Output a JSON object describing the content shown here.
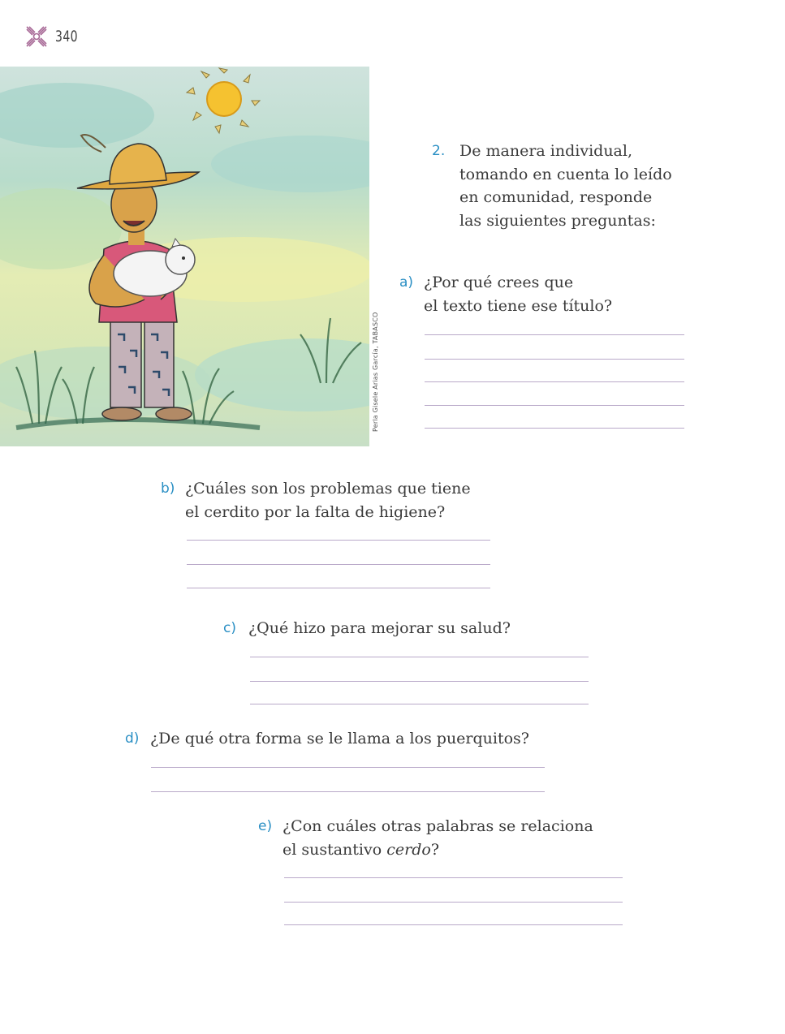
{
  "header": {
    "page_number": "340",
    "logo_icon": "decorative-cross-ornament-icon"
  },
  "illustration": {
    "description_icon": "farmer-holding-piglet-illustration",
    "credit": "Perla Gisele Arias García, TABASCO"
  },
  "activity": {
    "number": "2.",
    "instruction": [
      "De manera individual,",
      "tomando en cuenta lo leído",
      "en comunidad, responde",
      "las siguientes preguntas:"
    ]
  },
  "questions": {
    "a": {
      "label": "a)",
      "lines": [
        "¿Por qué crees que",
        "el texto tiene ese título?"
      ]
    },
    "b": {
      "label": "b)",
      "lines": [
        "¿Cuáles son los problemas que tiene",
        "el cerdito por la falta de higiene?"
      ]
    },
    "c": {
      "label": "c)",
      "lines": [
        "¿Qué hizo para mejorar su salud?"
      ]
    },
    "d": {
      "label": "d)",
      "lines": [
        "¿De qué otra forma se le llama a los puerquitos?"
      ]
    },
    "e": {
      "label": "e)",
      "line1": "¿Con cuáles otras palabras se relaciona",
      "line2_prefix": "el sustantivo ",
      "line2_em": "cerdo",
      "line2_suffix": "?"
    }
  },
  "colors": {
    "accent_blue": "#2a8fc4",
    "rule_lilac": "#b9a9c9",
    "logo_pink": "#a05a8c"
  }
}
